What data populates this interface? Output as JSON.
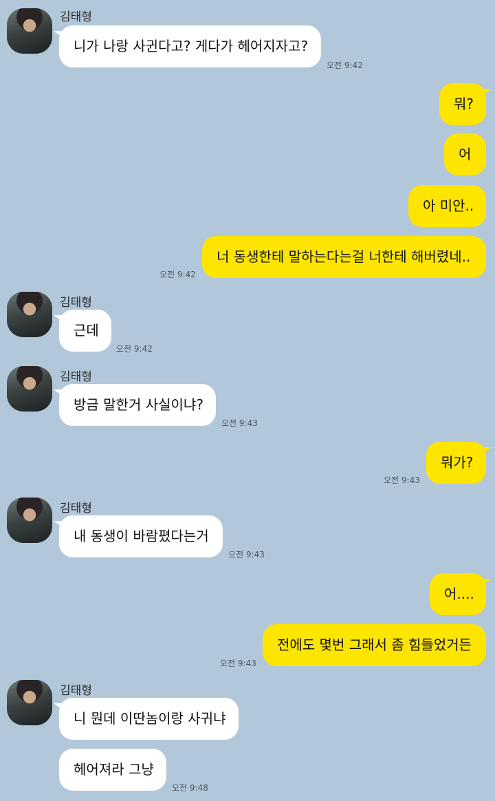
{
  "chat": {
    "sender_name": "김태형",
    "messages": [
      {
        "text": "니가 나랑 사귄다고? 게다가 헤어지자고?",
        "time": "오전 9:42"
      },
      {
        "text": "뭐?"
      },
      {
        "text": "어"
      },
      {
        "text": "아 미안.."
      },
      {
        "text": "너 동생한테 말하는다는걸 너한테 해버렸네..",
        "time": "오전 9:42"
      },
      {
        "text": "근데",
        "time": "오전 9:42"
      },
      {
        "text": "방금 말한거 사실이냐?",
        "time": "오전 9:43"
      },
      {
        "text": "뭐가?",
        "time": "오전 9:43"
      },
      {
        "text": "내 동생이 바람폈다는거",
        "time": "오전 9:43"
      },
      {
        "text": "어...."
      },
      {
        "text": "전에도 몇번 그래서 좀 힘들었거든",
        "time": "오전 9:43"
      },
      {
        "text": "니 뭔데 이딴놈이랑 사귀냐"
      },
      {
        "text": "헤어져라 그냥",
        "time": "오전 9:48"
      }
    ]
  },
  "colors": {
    "background": "#b2c7da",
    "incoming_bubble": "#ffffff",
    "outgoing_bubble": "#fee500"
  }
}
